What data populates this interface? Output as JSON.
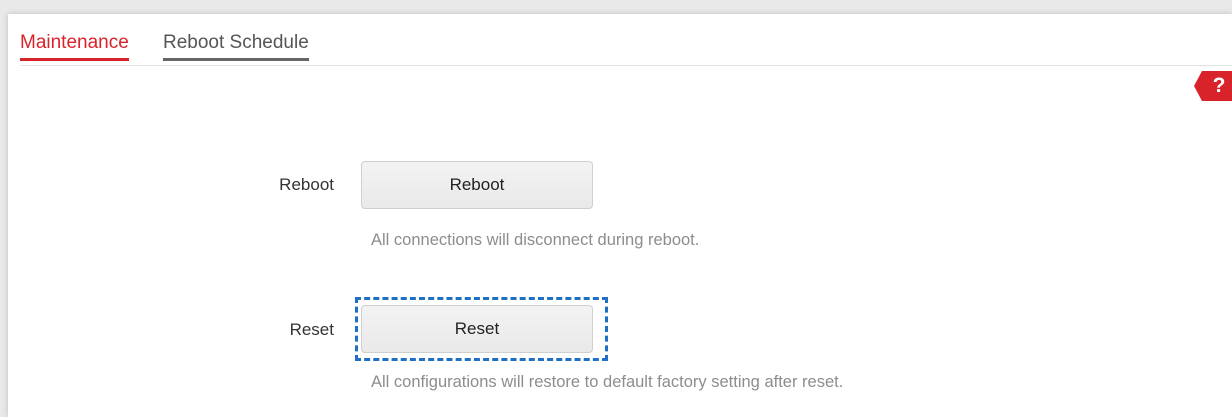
{
  "tabs": {
    "maintenance": "Maintenance",
    "reboot_schedule": "Reboot Schedule",
    "active": "Maintenance"
  },
  "help": {
    "icon": "question-icon",
    "symbol": "?",
    "color": "#d8232a"
  },
  "reboot": {
    "label": "Reboot",
    "button_label": "Reboot",
    "hint": "All connections will disconnect during reboot."
  },
  "reset": {
    "label": "Reset",
    "button_label": "Reset",
    "hint": "All configurations will restore to default factory setting after reset.",
    "highlighted": true
  },
  "colors": {
    "accent": "#d8232a",
    "tab_inactive": "#555555",
    "highlight_border": "#1f6fc5",
    "hint_text": "#8d8d8d"
  }
}
